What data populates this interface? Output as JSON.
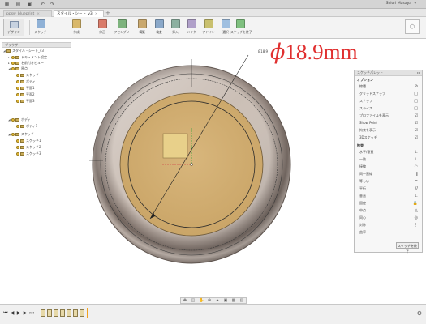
{
  "app": {
    "user_name": "Shiori Masaya",
    "tabs": [
      {
        "label": "ppsw_blueprint",
        "active": false
      },
      {
        "label": "スタイル・シート_v3",
        "active": true
      }
    ]
  },
  "toolbar": {
    "workspace_label": "デザイン",
    "tools": [
      {
        "label": "スケッチ",
        "icon": "sketch-icon",
        "color": "#8fb1d6"
      },
      {
        "label": "作成",
        "icon": "create-icon",
        "color": "#d9b86a"
      },
      {
        "label": "修正",
        "icon": "modify-icon",
        "color": "#d97b6a"
      },
      {
        "label": "アセンブリ",
        "icon": "assemble-icon",
        "color": "#7db37d"
      },
      {
        "label": "構築",
        "icon": "construct-icon",
        "color": "#c9a86e"
      },
      {
        "label": "検査",
        "icon": "inspect-icon",
        "color": "#8aa8c9"
      },
      {
        "label": "挿入",
        "icon": "insert-icon",
        "color": "#8cb0a0"
      },
      {
        "label": "メイク",
        "icon": "make-icon",
        "color": "#b0a0c9"
      },
      {
        "label": "アドイン",
        "icon": "addin-icon",
        "color": "#c9c06e"
      },
      {
        "label": "選択",
        "icon": "select-icon",
        "color": "#9fbfe0"
      }
    ]
  },
  "browser": {
    "title": "ブラウザ",
    "items": [
      {
        "label": "スタイル・シート_v3",
        "indent": 0
      },
      {
        "label": "ドキュメント設定",
        "indent": 1
      },
      {
        "label": "名前付きビュー",
        "indent": 1
      },
      {
        "label": "原点",
        "indent": 1
      },
      {
        "label": "スケッチ",
        "indent": 2
      },
      {
        "label": "ボディ",
        "indent": 2
      },
      {
        "label": "平面1",
        "indent": 2
      },
      {
        "label": "平面2",
        "indent": 2
      },
      {
        "label": "平面3",
        "indent": 2
      },
      {
        "label": "ボディ",
        "indent": 1
      },
      {
        "label": "ボディ1",
        "indent": 2
      },
      {
        "label": "スケッチ",
        "indent": 1
      },
      {
        "label": "スケッチ1",
        "indent": 2
      },
      {
        "label": "スケッチ2",
        "indent": 2
      },
      {
        "label": "スケッチ3",
        "indent": 2
      }
    ]
  },
  "viewport": {
    "dimension_symbol": "ϕ",
    "dimension_value": "18.9mm",
    "dimension_small": "Ø18.9"
  },
  "sketch_palette": {
    "title": "スケッチパレット",
    "options_header": "オプション",
    "options": [
      {
        "label": "線種",
        "icon": "⊘"
      },
      {
        "label": "グリッドスナップ",
        "icon": "□"
      },
      {
        "label": "スナップ",
        "icon": "□"
      },
      {
        "label": "スライス",
        "icon": "□"
      },
      {
        "label": "プロファイルを表示",
        "icon": "☑"
      },
      {
        "label": "Show Point",
        "icon": "☑"
      },
      {
        "label": "拘束を表示",
        "icon": "☑"
      },
      {
        "label": "3Dスケッチ",
        "icon": "☑"
      }
    ],
    "constraints_header": "拘束",
    "constraints": [
      {
        "label": "水平/垂直",
        "icon": "⊥"
      },
      {
        "label": "一致",
        "icon": "⊥"
      },
      {
        "label": "接線",
        "icon": "◠"
      },
      {
        "label": "同一直線",
        "icon": "∥"
      },
      {
        "label": "等しい",
        "icon": "="
      },
      {
        "label": "平行",
        "icon": "//"
      },
      {
        "label": "垂直",
        "icon": "⊥"
      },
      {
        "label": "固定",
        "icon": "🔒"
      },
      {
        "label": "中点",
        "icon": "△"
      },
      {
        "label": "同心",
        "icon": "◎"
      },
      {
        "label": "対称",
        "icon": "⋮"
      },
      {
        "label": "曲率",
        "icon": "∽"
      }
    ],
    "finish_button": "スケッチを終了"
  }
}
